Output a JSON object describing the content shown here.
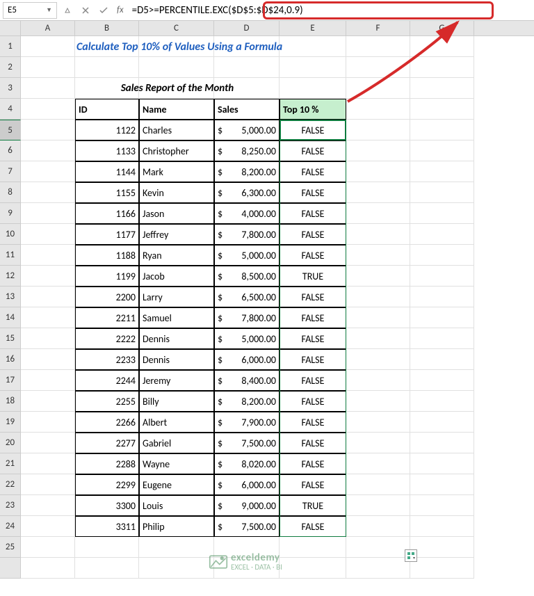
{
  "name_box": "E5",
  "formula": "=D5>=PERCENTILE.EXC($D$5:$D$24,0.9)",
  "col_headers": [
    "A",
    "B",
    "C",
    "D",
    "E",
    "F",
    "G"
  ],
  "row_headers": [
    "1",
    "2",
    "3",
    "4",
    "5",
    "6",
    "7",
    "8",
    "9",
    "10",
    "11",
    "12",
    "13",
    "14",
    "15",
    "16",
    "17",
    "18",
    "19",
    "20",
    "21",
    "22",
    "23",
    "24",
    "25"
  ],
  "title": "Calculate Top 10% of Values Using a Formula",
  "subtitle": "Sales Report of the Month",
  "headers": {
    "id": "ID",
    "name": "Name",
    "sales": "Sales",
    "top": "Top 10 %"
  },
  "currency": "$",
  "rows": [
    {
      "id": "1122",
      "name": "Charles",
      "sales": "5,000.00",
      "top": "FALSE"
    },
    {
      "id": "1133",
      "name": "Christopher",
      "sales": "8,250.00",
      "top": "FALSE"
    },
    {
      "id": "1144",
      "name": "Mark",
      "sales": "8,200.00",
      "top": "FALSE"
    },
    {
      "id": "1155",
      "name": "Kevin",
      "sales": "6,300.00",
      "top": "FALSE"
    },
    {
      "id": "1166",
      "name": "Jason",
      "sales": "4,000.00",
      "top": "FALSE"
    },
    {
      "id": "1177",
      "name": "Jeffrey",
      "sales": "7,800.00",
      "top": "FALSE"
    },
    {
      "id": "1188",
      "name": "Ryan",
      "sales": "5,000.00",
      "top": "FALSE"
    },
    {
      "id": "1199",
      "name": "Jacob",
      "sales": "8,500.00",
      "top": "TRUE"
    },
    {
      "id": "2200",
      "name": "Larry",
      "sales": "6,500.00",
      "top": "FALSE"
    },
    {
      "id": "2211",
      "name": "Samuel",
      "sales": "7,800.00",
      "top": "FALSE"
    },
    {
      "id": "2222",
      "name": "Dennis",
      "sales": "5,000.00",
      "top": "FALSE"
    },
    {
      "id": "2233",
      "name": "Dennis",
      "sales": "6,000.00",
      "top": "FALSE"
    },
    {
      "id": "2244",
      "name": "Jeremy",
      "sales": "8,400.00",
      "top": "FALSE"
    },
    {
      "id": "2255",
      "name": "Billy",
      "sales": "8,200.00",
      "top": "FALSE"
    },
    {
      "id": "2266",
      "name": "Albert",
      "sales": "7,900.00",
      "top": "FALSE"
    },
    {
      "id": "2277",
      "name": "Gabriel",
      "sales": "7,500.00",
      "top": "FALSE"
    },
    {
      "id": "2288",
      "name": "Wayne",
      "sales": "8,020.00",
      "top": "FALSE"
    },
    {
      "id": "2299",
      "name": "Eugene",
      "sales": "6,000.00",
      "top": "FALSE"
    },
    {
      "id": "3300",
      "name": "Louis",
      "sales": "9,000.00",
      "top": "TRUE"
    },
    {
      "id": "3311",
      "name": "Philip",
      "sales": "7,500.00",
      "top": "FALSE"
    }
  ],
  "watermark": {
    "name": "exceldemy",
    "tag": "EXCEL · DATA · BI"
  }
}
